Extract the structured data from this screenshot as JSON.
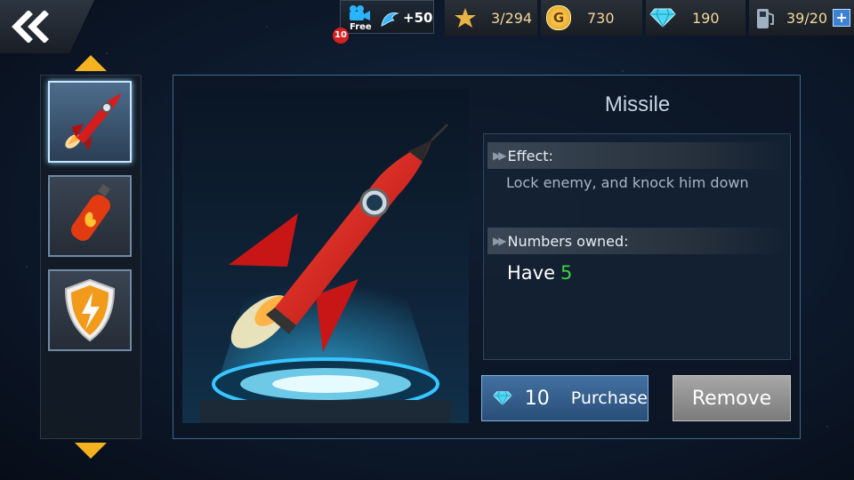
{
  "topbar": {
    "video_badge_count": "10",
    "video_free_label": "Free",
    "video_bonus": "+50",
    "stars": "3/294",
    "gold": "730",
    "diamonds": "190",
    "fuel": "39/20",
    "plus_label": "+"
  },
  "items": [
    {
      "icon": "rocket-icon",
      "selected": true
    },
    {
      "icon": "fire-extinguisher-icon",
      "selected": false
    },
    {
      "icon": "lightning-shield-icon",
      "selected": false
    }
  ],
  "detail": {
    "title": "Missile",
    "effect_heading": "Effect:",
    "effect_text": "Lock enemy, and knock him down",
    "owned_heading": "Numbers owned:",
    "have_label": "Have",
    "have_count": "5"
  },
  "actions": {
    "purchase_cost": "10",
    "purchase_label": "Purchase",
    "remove_label": "Remove"
  },
  "colors": {
    "accent_gold": "#f6b31f",
    "count_green": "#3ed23e",
    "purchase_blue": "#2a4e78",
    "remove_gray": "#8a8a8a"
  }
}
